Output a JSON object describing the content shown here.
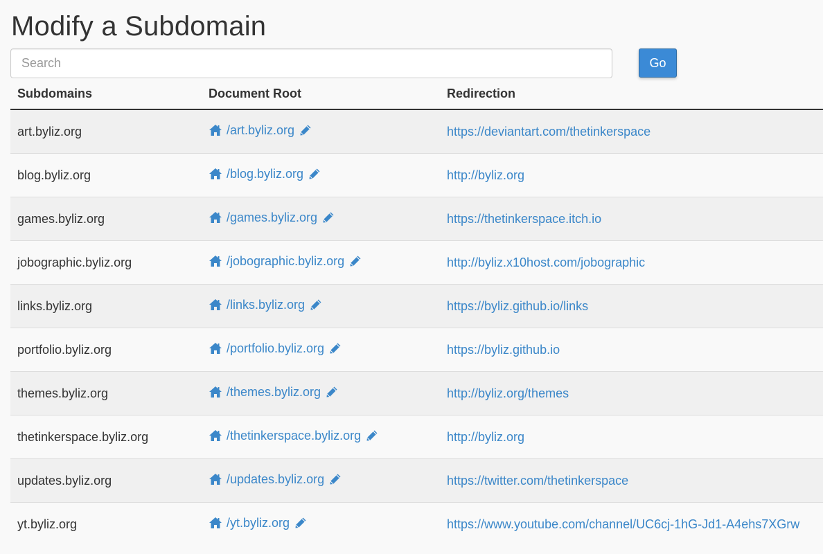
{
  "page": {
    "title": "Modify a Subdomain"
  },
  "search": {
    "placeholder": "Search",
    "value": "",
    "go_label": "Go"
  },
  "table": {
    "headers": {
      "subdomains": "Subdomains",
      "document_root": "Document Root",
      "redirection": "Redirection"
    },
    "rows": [
      {
        "subdomain": "art.byliz.org",
        "document_root": "/art.byliz.org",
        "redirection": "https://deviantart.com/thetinkerspace"
      },
      {
        "subdomain": "blog.byliz.org",
        "document_root": "/blog.byliz.org",
        "redirection": "http://byliz.org"
      },
      {
        "subdomain": "games.byliz.org",
        "document_root": "/games.byliz.org",
        "redirection": "https://thetinkerspace.itch.io"
      },
      {
        "subdomain": "jobographic.byliz.org",
        "document_root": "/jobographic.byliz.org",
        "redirection": "http://byliz.x10host.com/jobographic"
      },
      {
        "subdomain": "links.byliz.org",
        "document_root": "/links.byliz.org",
        "redirection": "https://byliz.github.io/links"
      },
      {
        "subdomain": "portfolio.byliz.org",
        "document_root": "/portfolio.byliz.org",
        "redirection": "https://byliz.github.io"
      },
      {
        "subdomain": "themes.byliz.org",
        "document_root": "/themes.byliz.org",
        "redirection": "http://byliz.org/themes"
      },
      {
        "subdomain": "thetinkerspace.byliz.org",
        "document_root": "/thetinkerspace.byliz.org",
        "redirection": "http://byliz.org"
      },
      {
        "subdomain": "updates.byliz.org",
        "document_root": "/updates.byliz.org",
        "redirection": "https://twitter.com/thetinkerspace"
      },
      {
        "subdomain": "yt.byliz.org",
        "document_root": "/yt.byliz.org",
        "redirection": "https://www.youtube.com/channel/UC6cj-1hG-Jd1-A4ehs7XGrw"
      }
    ]
  },
  "icons": {
    "home": "home-icon",
    "edit": "pencil-icon"
  },
  "colors": {
    "link": "#3b87c9",
    "primary_button": "#3b8ad6"
  }
}
